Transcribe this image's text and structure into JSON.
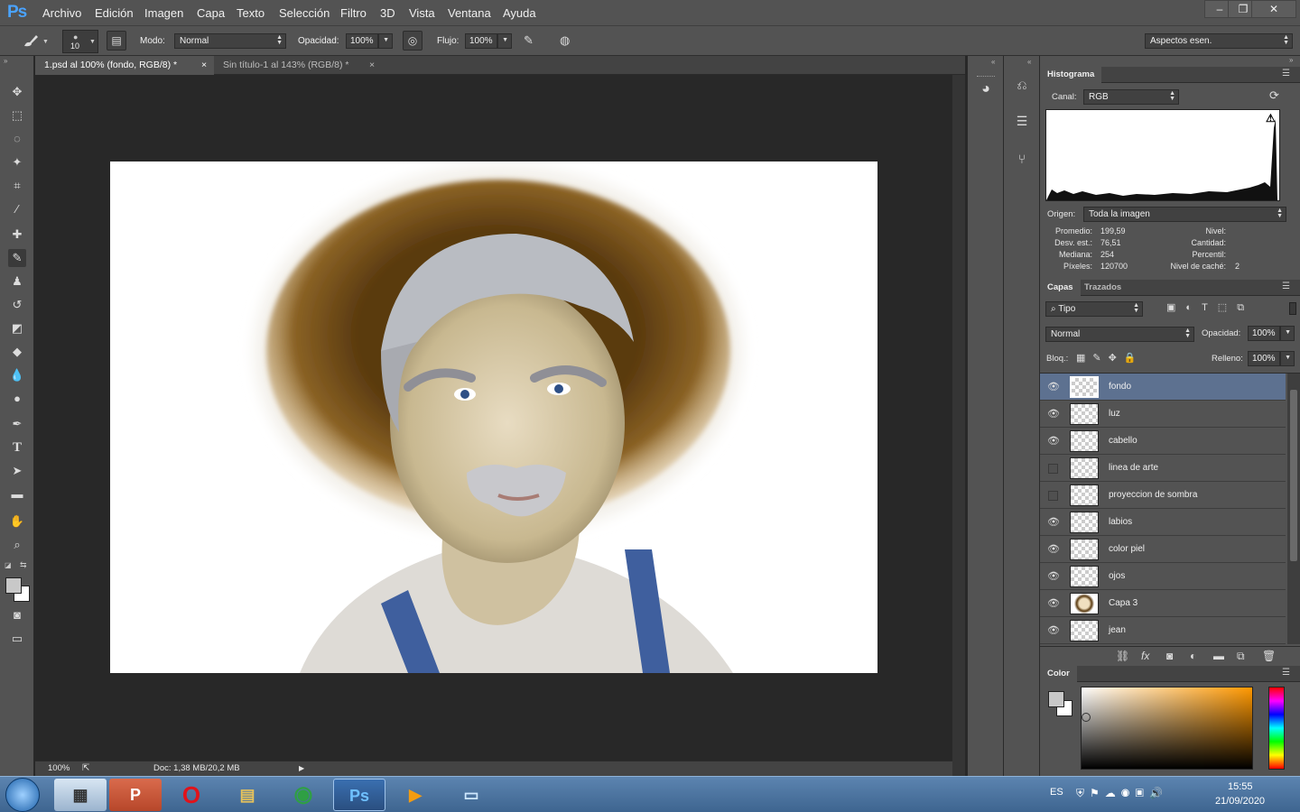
{
  "app": {
    "name": "Photoshop",
    "logo": "Ps"
  },
  "menu": [
    "Archivo",
    "Edición",
    "Imagen",
    "Capa",
    "Texto",
    "Selección",
    "Filtro",
    "3D",
    "Vista",
    "Ventana",
    "Ayuda"
  ],
  "window_controls": {
    "minimize": "–",
    "restore": "❐",
    "close": "✕"
  },
  "options": {
    "brush_size": "10",
    "mode_label": "Modo:",
    "mode_value": "Normal",
    "opacity_label": "Opacidad:",
    "opacity_value": "100%",
    "flow_label": "Flujo:",
    "flow_value": "100%",
    "workspace": "Aspectos esen."
  },
  "tabs": [
    {
      "label": "1.psd al 100% (fondo, RGB/8) *",
      "active": true
    },
    {
      "label": "Sin título-1 al 143% (RGB/8) *",
      "active": false
    }
  ],
  "status": {
    "zoom": "100%",
    "doc": "Doc: 1,38 MB/20,2 MB"
  },
  "histogram": {
    "tab": "Histograma",
    "channel_label": "Canal:",
    "channel_value": "RGB",
    "source_label": "Origen:",
    "source_value": "Toda la imagen",
    "stats": {
      "mean_label": "Promedio:",
      "mean": "199,59",
      "std_label": "Desv. est.:",
      "std": "76,51",
      "median_label": "Mediana:",
      "median": "254",
      "pixels_label": "Píxeles:",
      "pixels": "120700",
      "level_label": "Nivel:",
      "count_label": "Cantidad:",
      "percentile_label": "Percentil:",
      "cache_label": "Nivel de caché:",
      "cache": "2"
    }
  },
  "layers_panel": {
    "tabs": [
      "Capas",
      "Trazados"
    ],
    "filter_value": "Tipo",
    "blend_value": "Normal",
    "opacity_label": "Opacidad:",
    "opacity_value": "100%",
    "lock_label": "Bloq.:",
    "fill_label": "Relleno:",
    "fill_value": "100%",
    "layers": [
      {
        "name": "fondo",
        "visible": true,
        "selected": true
      },
      {
        "name": "luz",
        "visible": true,
        "selected": false
      },
      {
        "name": "cabello",
        "visible": true,
        "selected": false
      },
      {
        "name": "linea de arte",
        "visible": false,
        "selected": false
      },
      {
        "name": "proyeccion de sombra",
        "visible": false,
        "selected": false
      },
      {
        "name": "labios",
        "visible": true,
        "selected": false
      },
      {
        "name": "color piel",
        "visible": true,
        "selected": false
      },
      {
        "name": "ojos",
        "visible": true,
        "selected": false
      },
      {
        "name": "Capa 3",
        "visible": true,
        "selected": false
      },
      {
        "name": "jean",
        "visible": true,
        "selected": false
      }
    ]
  },
  "color_panel": {
    "tab": "Color"
  },
  "taskbar": {
    "lang": "ES",
    "time": "15:55",
    "date": "21/09/2020",
    "apps": [
      "calculator",
      "powerpoint",
      "opera",
      "file-explorer",
      "chrome",
      "photoshop",
      "media-player",
      "photos"
    ]
  },
  "colors": {
    "accent": "#5d7190",
    "panel": "#535353",
    "canvas_bg": "#282828"
  }
}
